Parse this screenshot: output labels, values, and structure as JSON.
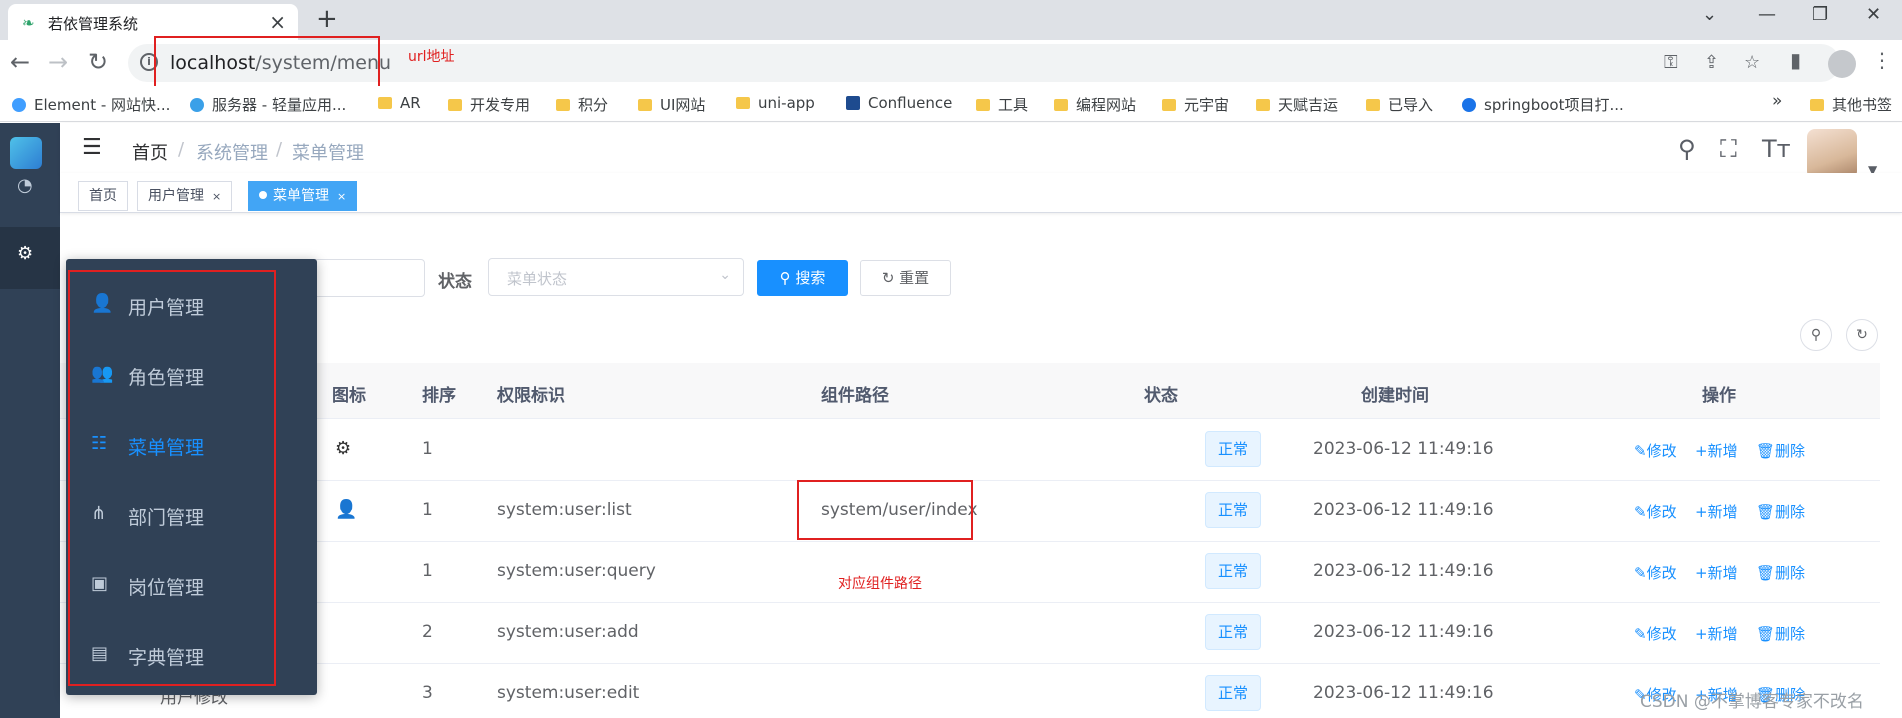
{
  "browser": {
    "tab_title": "若依管理系统",
    "url_host": "localhost",
    "url_path": "/system/menu",
    "annotation_url": "url地址",
    "bookmarks": [
      "Element - 网站快...",
      "服务器 - 轻量应用...",
      "AR",
      "开发专用",
      "积分",
      "UI网站",
      "uni-app",
      "Confluence",
      "工具",
      "编程网站",
      "元宇宙",
      "天赋吉运",
      "已导入",
      "springboot项目打..."
    ],
    "more_bookmarks": "»",
    "other_bookmarks": "其他书签"
  },
  "header": {
    "breadcrumb": [
      "首页",
      "系统管理",
      "菜单管理"
    ],
    "breadcrumb_sep": "/"
  },
  "tags": [
    {
      "label": "首页"
    },
    {
      "label": "用户管理",
      "close": "×"
    },
    {
      "label": "菜单管理",
      "close": "×"
    }
  ],
  "search": {
    "status_label": "状态",
    "status_placeholder": "菜单状态",
    "search_button": "搜索",
    "reset_button": "重置"
  },
  "table": {
    "headers": [
      "图标",
      "排序",
      "权限标识",
      "组件路径",
      "状态",
      "创建时间",
      "操作"
    ],
    "rows": [
      {
        "sort": "1",
        "perm": "",
        "component": "",
        "status": "正常",
        "created": "2023-06-12 11:49:16",
        "icon": "gear-icon"
      },
      {
        "sort": "1",
        "perm": "system:user:list",
        "component": "system/user/index",
        "status": "正常",
        "created": "2023-06-12 11:49:16",
        "icon": "user-icon"
      },
      {
        "sort": "1",
        "perm": "system:user:query",
        "component": "",
        "status": "正常",
        "created": "2023-06-12 11:49:16"
      },
      {
        "sort": "2",
        "perm": "system:user:add",
        "component": "",
        "status": "正常",
        "created": "2023-06-12 11:49:16"
      },
      {
        "sort": "3",
        "perm": "system:user:edit",
        "component": "",
        "status": "正常",
        "created": "2023-06-12 11:49:16",
        "name_fragment": "用户修改"
      }
    ],
    "op_edit": "修改",
    "op_add": "新增",
    "op_delete": "删除"
  },
  "annotation_component": "对应组件路径",
  "flyout": [
    {
      "label": "用户管理",
      "icon": "user-icon"
    },
    {
      "label": "角色管理",
      "icon": "users-icon"
    },
    {
      "label": "菜单管理",
      "icon": "tree-table-icon",
      "active": true
    },
    {
      "label": "部门管理",
      "icon": "tree-icon"
    },
    {
      "label": "岗位管理",
      "icon": "post-icon"
    },
    {
      "label": "字典管理",
      "icon": "dict-icon"
    }
  ],
  "watermark": "CSDN @不掌博客专家不改名",
  "colors": {
    "primary": "#1890ff",
    "sidebar": "#304156",
    "annotation": "#e02020"
  }
}
